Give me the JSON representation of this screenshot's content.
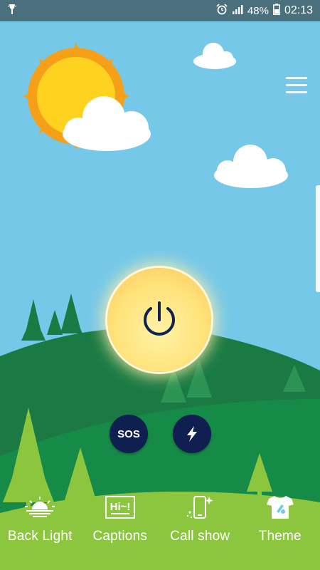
{
  "status_bar": {
    "battery_percent": "48%",
    "time": "02:13",
    "icons": [
      "flashlight-icon",
      "alarm-icon",
      "signal-icon",
      "battery-icon"
    ]
  },
  "controls": {
    "sos_label": "SOS"
  },
  "bottom_nav": {
    "items": [
      {
        "label": "Back Light",
        "icon": "backlight-sunrise-icon"
      },
      {
        "label": "Captions",
        "icon": "captions-hi-icon"
      },
      {
        "label": "Call show",
        "icon": "call-show-phone-icon"
      },
      {
        "label": "Theme",
        "icon": "theme-shirt-icon"
      }
    ]
  },
  "colors": {
    "sky": "#76c8e8",
    "hill_dark": "#1a7a43",
    "hill_mid": "#168444",
    "ground_light": "#8cc63f",
    "sun": "#ffd21f",
    "sun_rays": "#f6a01a",
    "button_dark": "#0f1f4f"
  }
}
